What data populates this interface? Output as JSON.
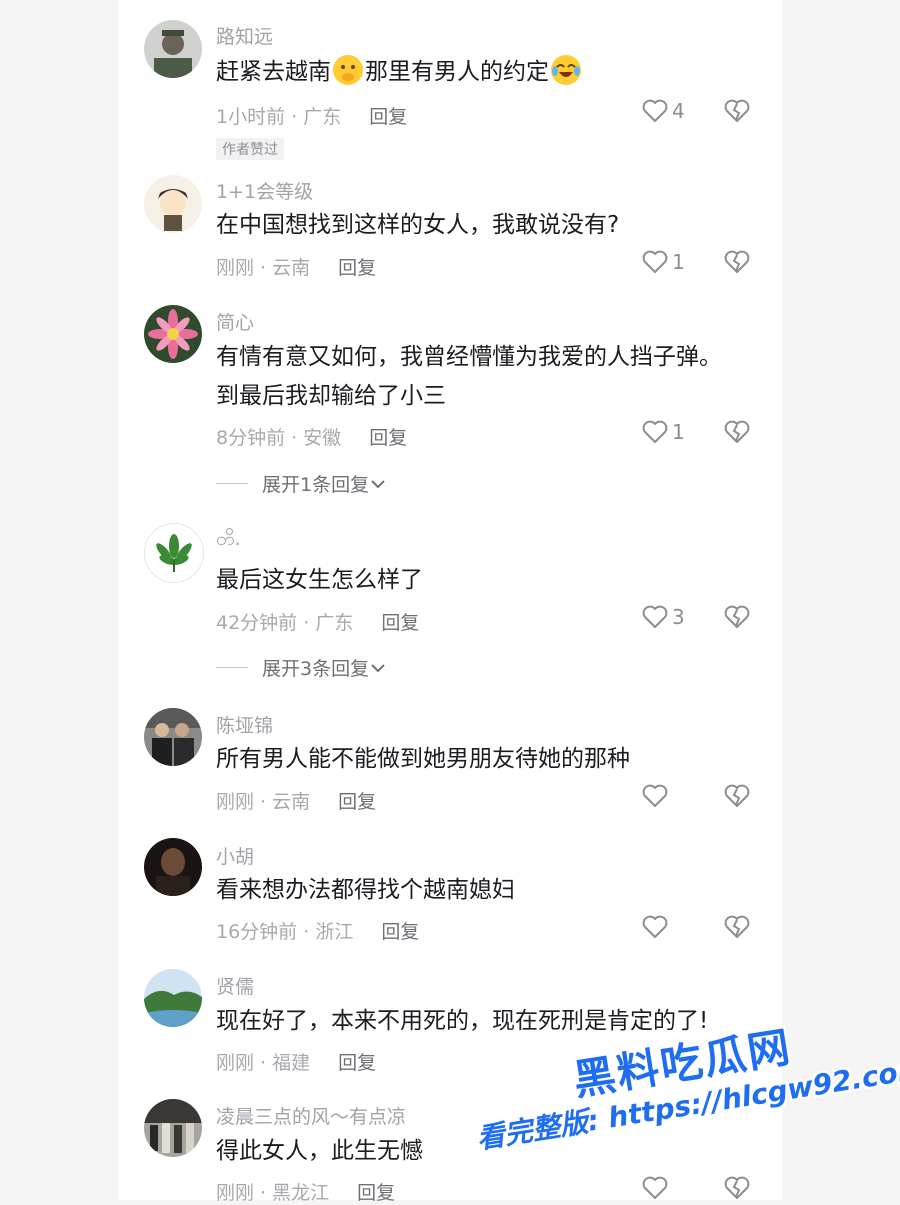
{
  "comments": [
    {
      "user": "路知远",
      "text_before": "赶紧去越南",
      "text_mid": "那里有男人的约定",
      "time": "1小时前",
      "location": "广东",
      "reply": "回复",
      "likes": "4",
      "badge": "作者赞过"
    },
    {
      "user": "1+1会等级",
      "text": "在中国想找到这样的女人，我敢说没有?",
      "time": "刚刚",
      "location": "云南",
      "reply": "回复",
      "likes": "1"
    },
    {
      "user": "简心",
      "text": "有情有意又如何，我曾经懵懂为我爱的人挡子弹。",
      "text2": "到最后我却输给了小三",
      "time": "8分钟前",
      "location": "安徽",
      "reply": "回复",
      "likes": "1",
      "expand": "展开1条回复"
    },
    {
      "user": "တိ.",
      "text": "最后这女生怎么样了",
      "time": "42分钟前",
      "location": "广东",
      "reply": "回复",
      "likes": "3",
      "expand": "展开3条回复"
    },
    {
      "user": "陈垭锦",
      "text": "所有男人能不能做到她男朋友待她的那种",
      "time": "刚刚",
      "location": "云南",
      "reply": "回复",
      "likes": ""
    },
    {
      "user": "小胡",
      "text": "看来想办法都得找个越南媳妇",
      "time": "16分钟前",
      "location": "浙江",
      "reply": "回复",
      "likes": ""
    },
    {
      "user": "贤儒",
      "text": "现在好了，本来不用死的，现在死刑是肯定的了!",
      "time": "刚刚",
      "location": "福建",
      "reply": "回复",
      "likes": ""
    },
    {
      "user": "凌晨三点的风～有点凉",
      "text": "得此女人，此生无憾",
      "time": "刚刚",
      "location": "黑龙江",
      "reply": "回复",
      "likes": ""
    }
  ],
  "separator": " · ",
  "watermark": {
    "line1": "黑料吃瓜网",
    "line2": "看完整版: https://hlcgw92.com"
  }
}
